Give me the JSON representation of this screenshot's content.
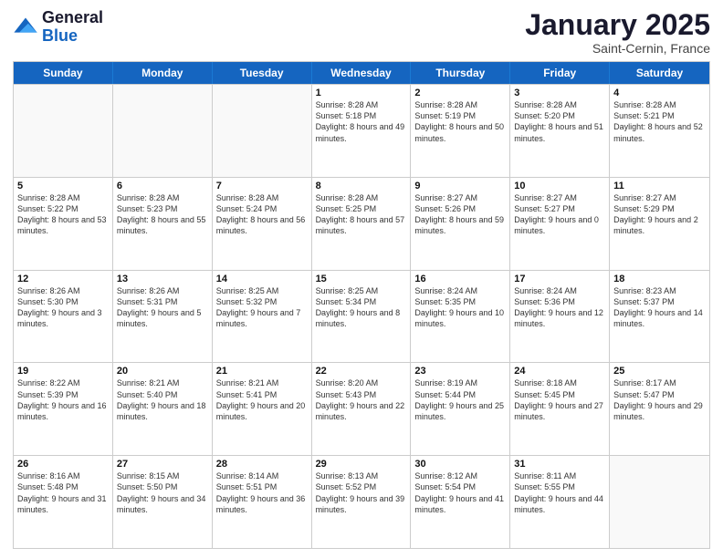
{
  "header": {
    "logo": {
      "general": "General",
      "blue": "Blue"
    },
    "month": "January 2025",
    "location": "Saint-Cernin, France"
  },
  "weekdays": [
    "Sunday",
    "Monday",
    "Tuesday",
    "Wednesday",
    "Thursday",
    "Friday",
    "Saturday"
  ],
  "rows": [
    [
      {
        "day": "",
        "sunrise": "",
        "sunset": "",
        "daylight": ""
      },
      {
        "day": "",
        "sunrise": "",
        "sunset": "",
        "daylight": ""
      },
      {
        "day": "",
        "sunrise": "",
        "sunset": "",
        "daylight": ""
      },
      {
        "day": "1",
        "sunrise": "Sunrise: 8:28 AM",
        "sunset": "Sunset: 5:18 PM",
        "daylight": "Daylight: 8 hours and 49 minutes."
      },
      {
        "day": "2",
        "sunrise": "Sunrise: 8:28 AM",
        "sunset": "Sunset: 5:19 PM",
        "daylight": "Daylight: 8 hours and 50 minutes."
      },
      {
        "day": "3",
        "sunrise": "Sunrise: 8:28 AM",
        "sunset": "Sunset: 5:20 PM",
        "daylight": "Daylight: 8 hours and 51 minutes."
      },
      {
        "day": "4",
        "sunrise": "Sunrise: 8:28 AM",
        "sunset": "Sunset: 5:21 PM",
        "daylight": "Daylight: 8 hours and 52 minutes."
      }
    ],
    [
      {
        "day": "5",
        "sunrise": "Sunrise: 8:28 AM",
        "sunset": "Sunset: 5:22 PM",
        "daylight": "Daylight: 8 hours and 53 minutes."
      },
      {
        "day": "6",
        "sunrise": "Sunrise: 8:28 AM",
        "sunset": "Sunset: 5:23 PM",
        "daylight": "Daylight: 8 hours and 55 minutes."
      },
      {
        "day": "7",
        "sunrise": "Sunrise: 8:28 AM",
        "sunset": "Sunset: 5:24 PM",
        "daylight": "Daylight: 8 hours and 56 minutes."
      },
      {
        "day": "8",
        "sunrise": "Sunrise: 8:28 AM",
        "sunset": "Sunset: 5:25 PM",
        "daylight": "Daylight: 8 hours and 57 minutes."
      },
      {
        "day": "9",
        "sunrise": "Sunrise: 8:27 AM",
        "sunset": "Sunset: 5:26 PM",
        "daylight": "Daylight: 8 hours and 59 minutes."
      },
      {
        "day": "10",
        "sunrise": "Sunrise: 8:27 AM",
        "sunset": "Sunset: 5:27 PM",
        "daylight": "Daylight: 9 hours and 0 minutes."
      },
      {
        "day": "11",
        "sunrise": "Sunrise: 8:27 AM",
        "sunset": "Sunset: 5:29 PM",
        "daylight": "Daylight: 9 hours and 2 minutes."
      }
    ],
    [
      {
        "day": "12",
        "sunrise": "Sunrise: 8:26 AM",
        "sunset": "Sunset: 5:30 PM",
        "daylight": "Daylight: 9 hours and 3 minutes."
      },
      {
        "day": "13",
        "sunrise": "Sunrise: 8:26 AM",
        "sunset": "Sunset: 5:31 PM",
        "daylight": "Daylight: 9 hours and 5 minutes."
      },
      {
        "day": "14",
        "sunrise": "Sunrise: 8:25 AM",
        "sunset": "Sunset: 5:32 PM",
        "daylight": "Daylight: 9 hours and 7 minutes."
      },
      {
        "day": "15",
        "sunrise": "Sunrise: 8:25 AM",
        "sunset": "Sunset: 5:34 PM",
        "daylight": "Daylight: 9 hours and 8 minutes."
      },
      {
        "day": "16",
        "sunrise": "Sunrise: 8:24 AM",
        "sunset": "Sunset: 5:35 PM",
        "daylight": "Daylight: 9 hours and 10 minutes."
      },
      {
        "day": "17",
        "sunrise": "Sunrise: 8:24 AM",
        "sunset": "Sunset: 5:36 PM",
        "daylight": "Daylight: 9 hours and 12 minutes."
      },
      {
        "day": "18",
        "sunrise": "Sunrise: 8:23 AM",
        "sunset": "Sunset: 5:37 PM",
        "daylight": "Daylight: 9 hours and 14 minutes."
      }
    ],
    [
      {
        "day": "19",
        "sunrise": "Sunrise: 8:22 AM",
        "sunset": "Sunset: 5:39 PM",
        "daylight": "Daylight: 9 hours and 16 minutes."
      },
      {
        "day": "20",
        "sunrise": "Sunrise: 8:21 AM",
        "sunset": "Sunset: 5:40 PM",
        "daylight": "Daylight: 9 hours and 18 minutes."
      },
      {
        "day": "21",
        "sunrise": "Sunrise: 8:21 AM",
        "sunset": "Sunset: 5:41 PM",
        "daylight": "Daylight: 9 hours and 20 minutes."
      },
      {
        "day": "22",
        "sunrise": "Sunrise: 8:20 AM",
        "sunset": "Sunset: 5:43 PM",
        "daylight": "Daylight: 9 hours and 22 minutes."
      },
      {
        "day": "23",
        "sunrise": "Sunrise: 8:19 AM",
        "sunset": "Sunset: 5:44 PM",
        "daylight": "Daylight: 9 hours and 25 minutes."
      },
      {
        "day": "24",
        "sunrise": "Sunrise: 8:18 AM",
        "sunset": "Sunset: 5:45 PM",
        "daylight": "Daylight: 9 hours and 27 minutes."
      },
      {
        "day": "25",
        "sunrise": "Sunrise: 8:17 AM",
        "sunset": "Sunset: 5:47 PM",
        "daylight": "Daylight: 9 hours and 29 minutes."
      }
    ],
    [
      {
        "day": "26",
        "sunrise": "Sunrise: 8:16 AM",
        "sunset": "Sunset: 5:48 PM",
        "daylight": "Daylight: 9 hours and 31 minutes."
      },
      {
        "day": "27",
        "sunrise": "Sunrise: 8:15 AM",
        "sunset": "Sunset: 5:50 PM",
        "daylight": "Daylight: 9 hours and 34 minutes."
      },
      {
        "day": "28",
        "sunrise": "Sunrise: 8:14 AM",
        "sunset": "Sunset: 5:51 PM",
        "daylight": "Daylight: 9 hours and 36 minutes."
      },
      {
        "day": "29",
        "sunrise": "Sunrise: 8:13 AM",
        "sunset": "Sunset: 5:52 PM",
        "daylight": "Daylight: 9 hours and 39 minutes."
      },
      {
        "day": "30",
        "sunrise": "Sunrise: 8:12 AM",
        "sunset": "Sunset: 5:54 PM",
        "daylight": "Daylight: 9 hours and 41 minutes."
      },
      {
        "day": "31",
        "sunrise": "Sunrise: 8:11 AM",
        "sunset": "Sunset: 5:55 PM",
        "daylight": "Daylight: 9 hours and 44 minutes."
      },
      {
        "day": "",
        "sunrise": "",
        "sunset": "",
        "daylight": ""
      }
    ]
  ]
}
